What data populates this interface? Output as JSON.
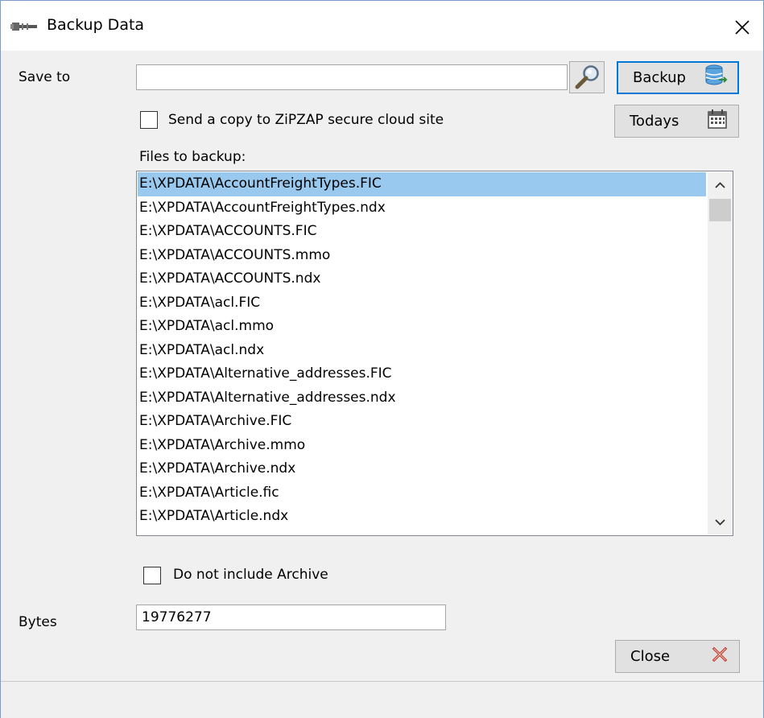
{
  "window": {
    "title": "Backup Data",
    "icon": "wrench-icon",
    "close_icon": "close-icon"
  },
  "save_to": {
    "label": "Save to",
    "value": "",
    "browse_icon": "magnifier-icon"
  },
  "buttons": {
    "backup_label": "Backup",
    "backup_icon": "database-icon",
    "todays_label": "Todays",
    "todays_icon": "calendar-icon",
    "close_label": "Close",
    "close_icon": "red-x-icon"
  },
  "cloud_copy": {
    "label": "Send a copy to ZiPZAP secure cloud site",
    "checked": false
  },
  "files": {
    "label": "Files to backup:",
    "selected_index": 0,
    "items": [
      "E:\\XPDATA\\AccountFreightTypes.FIC",
      "E:\\XPDATA\\AccountFreightTypes.ndx",
      "E:\\XPDATA\\ACCOUNTS.FIC",
      "E:\\XPDATA\\ACCOUNTS.mmo",
      "E:\\XPDATA\\ACCOUNTS.ndx",
      "E:\\XPDATA\\acl.FIC",
      "E:\\XPDATA\\acl.mmo",
      "E:\\XPDATA\\acl.ndx",
      "E:\\XPDATA\\Alternative_addresses.FIC",
      "E:\\XPDATA\\Alternative_addresses.ndx",
      "E:\\XPDATA\\Archive.FIC",
      "E:\\XPDATA\\Archive.mmo",
      "E:\\XPDATA\\Archive.ndx",
      "E:\\XPDATA\\Article.fic",
      "E:\\XPDATA\\Article.ndx"
    ]
  },
  "exclude_archive": {
    "label": "Do not include Archive",
    "checked": false
  },
  "bytes": {
    "label": "Bytes",
    "value": "19776277"
  },
  "colors": {
    "selection": "#99c9ef",
    "default_button_border": "#0078d7",
    "close_icon_red": "#c0392b"
  }
}
